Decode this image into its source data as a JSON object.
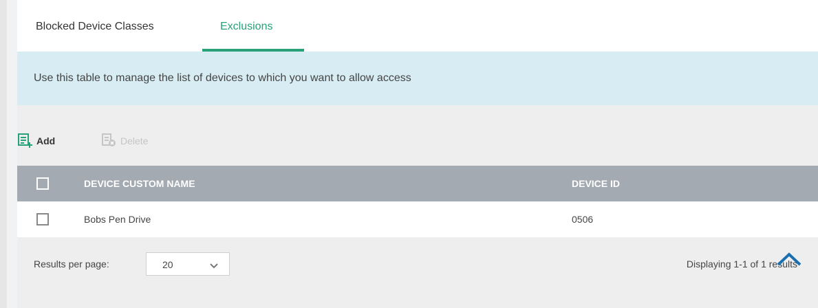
{
  "tabs": [
    {
      "label": "Blocked Device Classes"
    },
    {
      "label": "Exclusions"
    }
  ],
  "info": {
    "text": "Use this table to manage the list of devices to which you want to allow access"
  },
  "toolbar": {
    "add_label": "Add",
    "delete_label": "Delete"
  },
  "table": {
    "headers": [
      "DEVICE CUSTOM NAME",
      "DEVICE ID"
    ],
    "rows": [
      {
        "name": "Bobs Pen Drive",
        "device_id": "0506"
      }
    ]
  },
  "footer": {
    "results_per_page_label": "Results per page:",
    "results_per_page_value": "20",
    "results_text": "Displaying 1-1 of 1 results"
  },
  "colors": {
    "accent": "#28a07a",
    "info_bg": "#d8edf3",
    "header_bg": "#a4aab1"
  },
  "icons": [
    "add-list-icon",
    "delete-list-icon",
    "chevron-down-icon",
    "scroll-top-icon"
  ]
}
